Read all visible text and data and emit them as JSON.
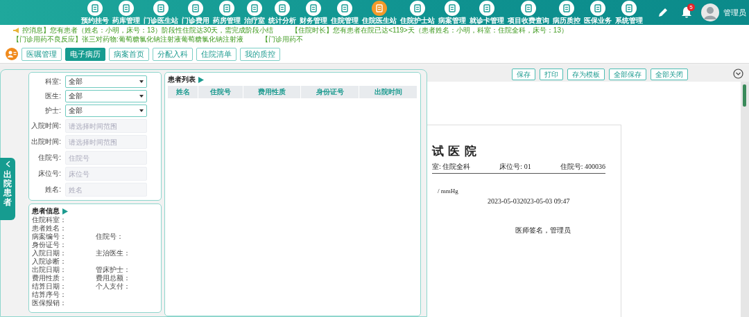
{
  "header": {
    "nav": [
      {
        "label": "预约挂号",
        "selected": false
      },
      {
        "label": "药库管理",
        "selected": false
      },
      {
        "label": "门诊医生站",
        "selected": false
      },
      {
        "label": "门诊费用",
        "selected": false
      },
      {
        "label": "药房管理",
        "selected": false
      },
      {
        "label": "治疗室",
        "selected": false
      },
      {
        "label": "统计分析",
        "selected": false
      },
      {
        "label": "财务管理",
        "selected": false
      },
      {
        "label": "住院管理",
        "selected": false
      },
      {
        "label": "住院医生站",
        "selected": true
      },
      {
        "label": "住院护士站",
        "selected": false
      },
      {
        "label": "病案管理",
        "selected": false
      },
      {
        "label": "就诊卡管理",
        "selected": false
      },
      {
        "label": "项目收费查询",
        "selected": false
      },
      {
        "label": "病历质控",
        "selected": false
      },
      {
        "label": "医保业务",
        "selected": false
      },
      {
        "label": "系统管理",
        "selected": false
      }
    ],
    "notification_count": "5",
    "user": "管理员"
  },
  "notices": [
    "控消息】您有患者（姓名：小明，床号：13）阶段性住院达30天，需完成阶段小结",
    "【住院时长】您有患者在院已达<119>天（患者姓名：小明，科室：住院全科，床号：13）",
    "【门诊用药不良反应】张三对药物:葡萄糖氯化钠注射液葡萄糖氯化钠注射液",
    "【门诊用药不"
  ],
  "module_tabs": [
    {
      "label": "医嘱管理",
      "selected": false
    },
    {
      "label": "电子病历",
      "selected": true
    },
    {
      "label": "病案首页",
      "selected": false
    },
    {
      "label": "分配入科",
      "selected": false
    },
    {
      "label": "住院清单",
      "selected": false
    },
    {
      "label": "我的质控",
      "selected": false
    }
  ],
  "editor": {
    "toolbar": [
      "保存",
      "打印",
      "存为模板",
      "全部保存",
      "全部关闭"
    ],
    "document": {
      "title": "试 医 院",
      "meta": [
        "室: 住院全科",
        "床位号: 01",
        "住院号: 400036"
      ],
      "vitals": "/ mmHg",
      "date": "2023-05-032023-05-03 09:47",
      "signature": "医师签名，管理员"
    }
  },
  "side_tab": "出院患者",
  "filters": [
    {
      "label": "科室:",
      "kind": "select",
      "value": "全部"
    },
    {
      "label": "医生:",
      "kind": "select",
      "value": "全部"
    },
    {
      "label": "护士:",
      "kind": "select",
      "value": "全部"
    },
    {
      "label": "入院时间:",
      "kind": "input",
      "placeholder": "请选择时间范围"
    },
    {
      "label": "出院时间:",
      "kind": "input",
      "placeholder": "请选择时间范围"
    },
    {
      "label": "住院号:",
      "kind": "input",
      "placeholder": "住院号"
    },
    {
      "label": "床位号:",
      "kind": "input",
      "placeholder": "床位号"
    },
    {
      "label": "姓名:",
      "kind": "input",
      "placeholder": "姓名"
    }
  ],
  "patient_list": {
    "title": "患者列表",
    "columns": [
      "姓名",
      "住院号",
      "费用性质",
      "身份证号",
      "出院时间"
    ]
  },
  "patient_info": {
    "title": "患者信息",
    "rows": [
      [
        "住院科室："
      ],
      [
        "患者姓名："
      ],
      [
        "病案编号：",
        "住院号："
      ],
      [
        "身份证号："
      ],
      [
        "入院日期：",
        "主治医生："
      ],
      [
        "入院诊断："
      ],
      [
        "出院日期：",
        "管床护士："
      ],
      [
        "费用性质：",
        "费用总额："
      ],
      [
        "结算日期：",
        "个人支付："
      ],
      [
        "结算序号："
      ],
      [
        "医保报销："
      ]
    ]
  }
}
